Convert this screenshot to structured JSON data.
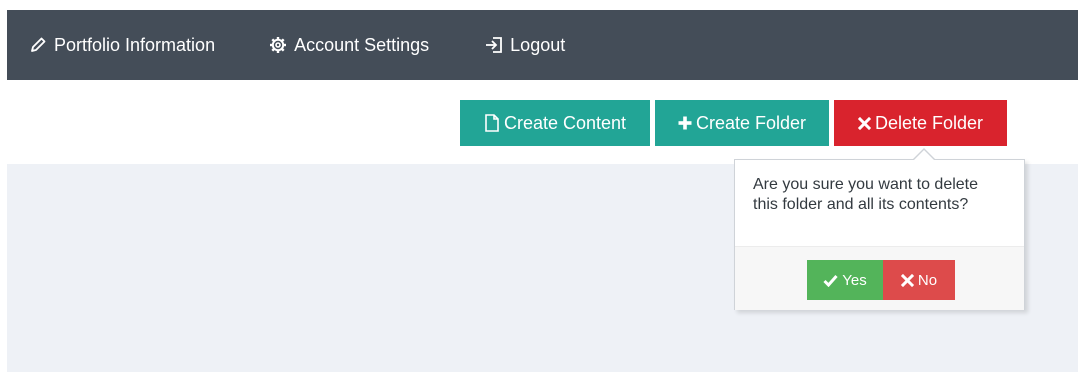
{
  "navbar": {
    "items": [
      {
        "label": "Portfolio Information",
        "icon": "pencil-icon"
      },
      {
        "label": "Account Settings",
        "icon": "gear-icon"
      },
      {
        "label": "Logout",
        "icon": "logout-icon"
      }
    ]
  },
  "toolbar": {
    "create_content_label": "Create Content",
    "create_folder_label": "Create Folder",
    "delete_folder_label": "Delete Folder"
  },
  "confirm_popover": {
    "message": "Are you sure you want to delete this folder and all its contents?",
    "yes_label": "Yes",
    "no_label": "No"
  },
  "colors": {
    "navbar_bg": "#444d58",
    "teal": "#22a596",
    "danger": "#d9232d",
    "success": "#53b45a",
    "no_red": "#dd4b4b",
    "content_bg": "#eef1f6"
  }
}
